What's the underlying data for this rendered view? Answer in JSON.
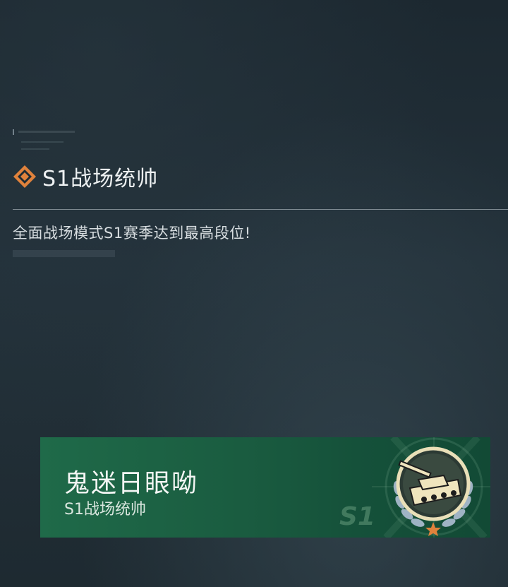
{
  "achievement": {
    "title": "S1战场统帅",
    "description": "全面战场模式S1赛季达到最高段位!",
    "icon": "orange-diamond-icon"
  },
  "card": {
    "player_name": "鬼迷日眼呦",
    "badge_title": "S1战场统帅",
    "season_mark": "S1",
    "emblem": "tank-laurel-badge-icon"
  },
  "colors": {
    "accent": "#e0823c",
    "card_green": "#1f6a49",
    "background": "#1f2b33"
  }
}
